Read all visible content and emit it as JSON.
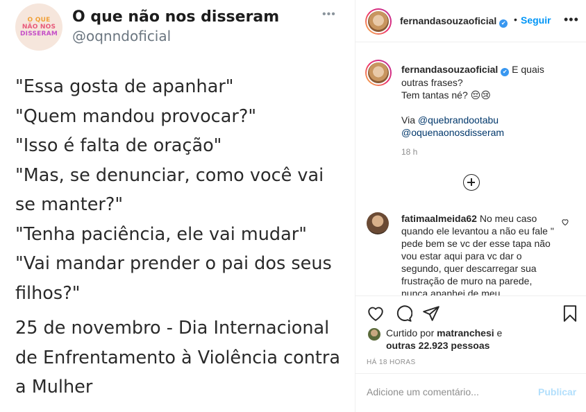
{
  "tweet": {
    "avatar_lines": [
      "O QUE",
      "NÃO NOS",
      "DISSERAM"
    ],
    "name": "O que não nos disseram",
    "handle": "@oqnndoficial",
    "more": "•••",
    "lines": [
      "\"Essa gosta de apanhar\"",
      "\"Quem mandou provocar?\"",
      "\"Isso é falta de oração\"",
      "\"Mas, se denunciar, como você vai",
      "se manter?\"",
      "\"Tenha paciência, ele vai mudar\"",
      "\"Vai mandar prender o pai dos seus",
      "filhos?\""
    ],
    "footer_lines": [
      "25 de novembro - Dia Internacional",
      "de Enfrentamento à Violência contra",
      "a Mulher"
    ]
  },
  "header": {
    "username": "fernandasouzaoficial",
    "verified_icon": "✔",
    "dot": "•",
    "follow_label": "Seguir",
    "more": "•••"
  },
  "caption": {
    "username": "fernandasouzaoficial",
    "text_1": "E quais outras frases?",
    "text_2": "Tem tantas né? 😔😢",
    "via_label": "Via ",
    "mention_1": "@quebrandootabu",
    "mention_2": "@oquenaonosdisseram",
    "time": "18 h"
  },
  "comment": {
    "username": "fatimaalmeida62",
    "text": "No meu caso quando ele levantou a não eu fale \" pede bem se vc der esse tapa não vou estar aqui para vc dar o segundo, quer descarregar sua frustração de muro na parede, nunca apanhei de meu"
  },
  "likes": {
    "prefix": "Curtido por ",
    "user": "matranchesi",
    "mid": " e",
    "others": "outras 22.923 pessoas"
  },
  "post_time": "HÁ 18 HORAS",
  "comment_box": {
    "placeholder": "Adicione um comentário...",
    "publish_label": "Publicar"
  },
  "colors": {
    "link_blue": "#0095f6",
    "publish_disabled": "#b2dffc",
    "mention": "#00376b"
  }
}
